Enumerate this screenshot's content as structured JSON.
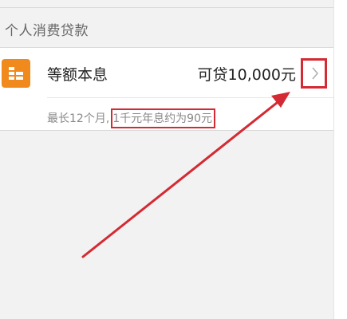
{
  "section": {
    "title": "个人消费贷款"
  },
  "product": {
    "name": "等额本息",
    "amount": "可贷10,000元",
    "term": "最长12个月,",
    "interest": "1千元年息约为90元"
  },
  "colors": {
    "accent_orange": "#f08a1c",
    "annotation_red": "#d42a34"
  },
  "icons": {
    "product_icon": "coin-stack-icon",
    "chevron": "chevron-right-icon"
  }
}
